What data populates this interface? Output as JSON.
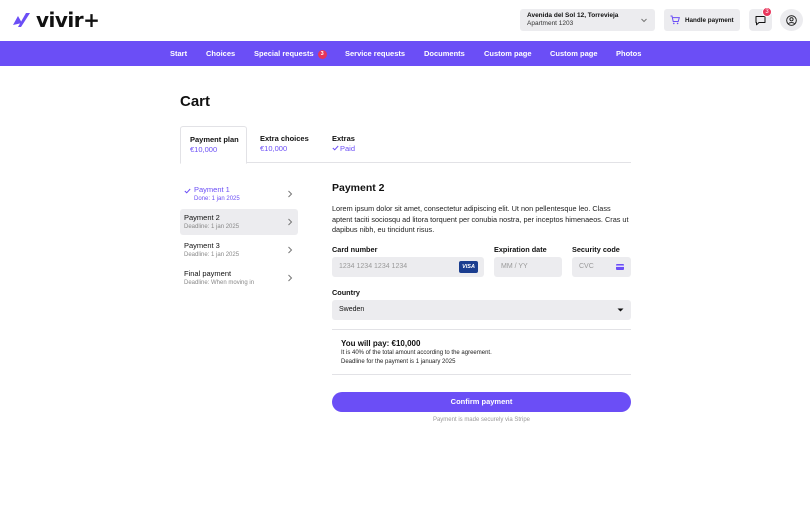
{
  "header": {
    "logo_text": "vivir+",
    "address": {
      "line1": "Avenida del Sol 12, Torrevieja",
      "line2": "Apartment 1203"
    },
    "handle_payment_label": "Handle payment",
    "messages_count": "3"
  },
  "nav": {
    "items": [
      {
        "label": "Start"
      },
      {
        "label": "Choices"
      },
      {
        "label": "Special requests",
        "badge": "3"
      },
      {
        "label": "Service requests"
      },
      {
        "label": "Documents"
      },
      {
        "label": "Custom page"
      },
      {
        "label": "Custom page"
      },
      {
        "label": "Photos"
      }
    ]
  },
  "page": {
    "title": "Cart",
    "tabs": [
      {
        "title": "Payment plan",
        "sub": "€10,000"
      },
      {
        "title": "Extra choices",
        "sub": "€10,000"
      },
      {
        "title": "Extras",
        "sub": "Paid"
      }
    ]
  },
  "steps": [
    {
      "title": "Payment 1",
      "sub": "Done: 1 jan 2025"
    },
    {
      "title": "Payment 2",
      "sub": "Deadline: 1 jan 2025"
    },
    {
      "title": "Payment 3",
      "sub": "Deadline: 1 jan 2025"
    },
    {
      "title": "Final payment",
      "sub": "Deadline: When moving in"
    }
  ],
  "form": {
    "title": "Payment 2",
    "description": "Lorem ipsum dolor sit amet, consectetur adipiscing elit. Ut non pellentesque leo. Class aptent taciti sociosqu ad litora torquent per conubia nostra, per inceptos himenaeos. Cras ut dapibus nibh, eu tincidunt risus.",
    "card_number_label": "Card number",
    "card_number_placeholder": "1234 1234 1234 1234",
    "card_brand": "VISA",
    "expiration_label": "Expiration date",
    "expiration_placeholder": "MM / YY",
    "security_label": "Security code",
    "security_placeholder": "CVC",
    "country_label": "Country",
    "country_value": "Sweden",
    "summary_title": "You will pay: €10,000",
    "summary_line1": "It is 40% of the total amount according to the agreement.",
    "summary_line2": "Deadline for the payment is 1 january 2025",
    "confirm_label": "Confirm payment",
    "secure_note": "Payment is made securely via Stripe"
  },
  "colors": {
    "accent": "#6b4ef6",
    "badge": "#e8345a",
    "field_bg": "#ececef",
    "visa_blue": "#1a3d8f"
  }
}
